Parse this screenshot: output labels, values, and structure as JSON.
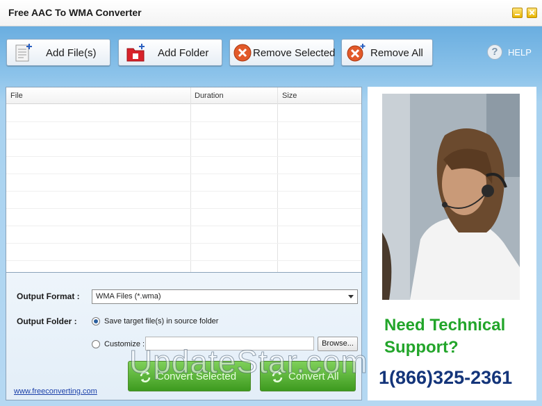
{
  "window": {
    "title": "Free AAC To WMA Converter"
  },
  "toolbar": {
    "add_files": "Add File(s)",
    "add_folder": "Add Folder",
    "remove_selected": "Remove Selected",
    "remove_all": "Remove All",
    "help": "HELP"
  },
  "file_list": {
    "columns": [
      "File",
      "Duration",
      "Size"
    ],
    "rows": []
  },
  "options": {
    "output_format_label": "Output Format :",
    "output_format_value": "WMA Files (*.wma)",
    "output_folder_label": "Output Folder :",
    "radio_source": "Save target file(s) in source folder",
    "radio_source_selected": true,
    "radio_customize": "Customize :",
    "customize_path": "",
    "browse": "Browse..."
  },
  "actions": {
    "convert_selected": "Convert Selected",
    "convert_all": "Convert All"
  },
  "footer": {
    "link": "www.freeconverting.com"
  },
  "ad": {
    "headline": "Need Technical Support?",
    "phone": "1(866)325-2361"
  },
  "watermark": "UpdateStar.com",
  "colors": {
    "toolbar_bg": "#6aaee0",
    "convert_button": "#3d9a1f",
    "ad_headline": "#22a52a",
    "ad_phone": "#14357a",
    "link": "#1a3fa8"
  }
}
